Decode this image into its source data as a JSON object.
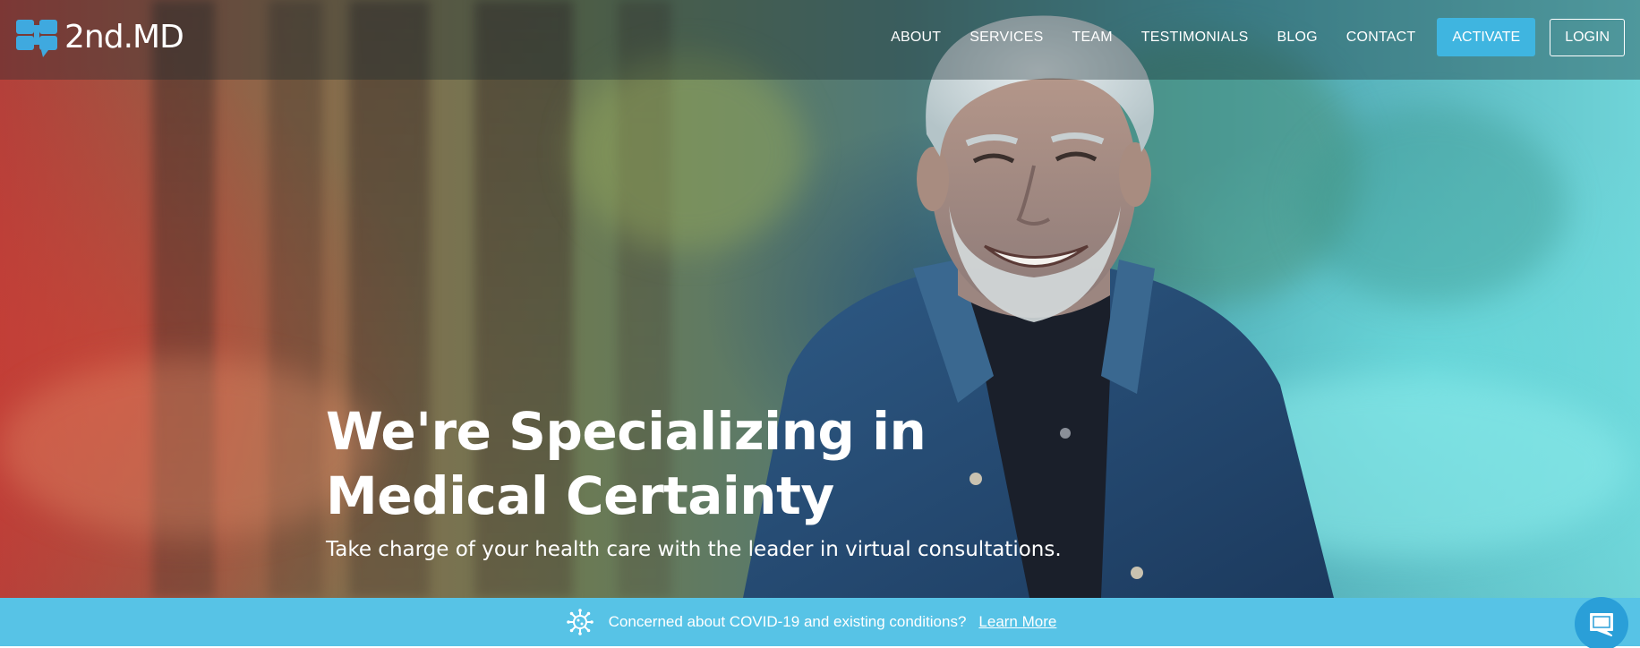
{
  "header": {
    "logo_text": "2nd.MD",
    "nav": [
      {
        "label": "ABOUT"
      },
      {
        "label": "SERVICES"
      },
      {
        "label": "TEAM"
      },
      {
        "label": "TESTIMONIALS"
      },
      {
        "label": "BLOG"
      },
      {
        "label": "CONTACT"
      }
    ],
    "activate_label": "ACTIVATE",
    "login_label": "LOGIN"
  },
  "hero": {
    "title_line1": "We're Specializing in",
    "title_line2": "Medical Certainty",
    "subtitle": "Take charge of your health care with the leader in virtual consultations."
  },
  "banner": {
    "text": "Concerned about COVID-19 and existing conditions?",
    "link_label": "Learn More",
    "icon": "virus-icon"
  },
  "chat": {
    "icon": "chat-icon"
  },
  "colors": {
    "accent": "#3fb5e0",
    "banner": "#57c3e6",
    "chat": "#2a9fd8",
    "logo_mark": "#3fa9df"
  }
}
